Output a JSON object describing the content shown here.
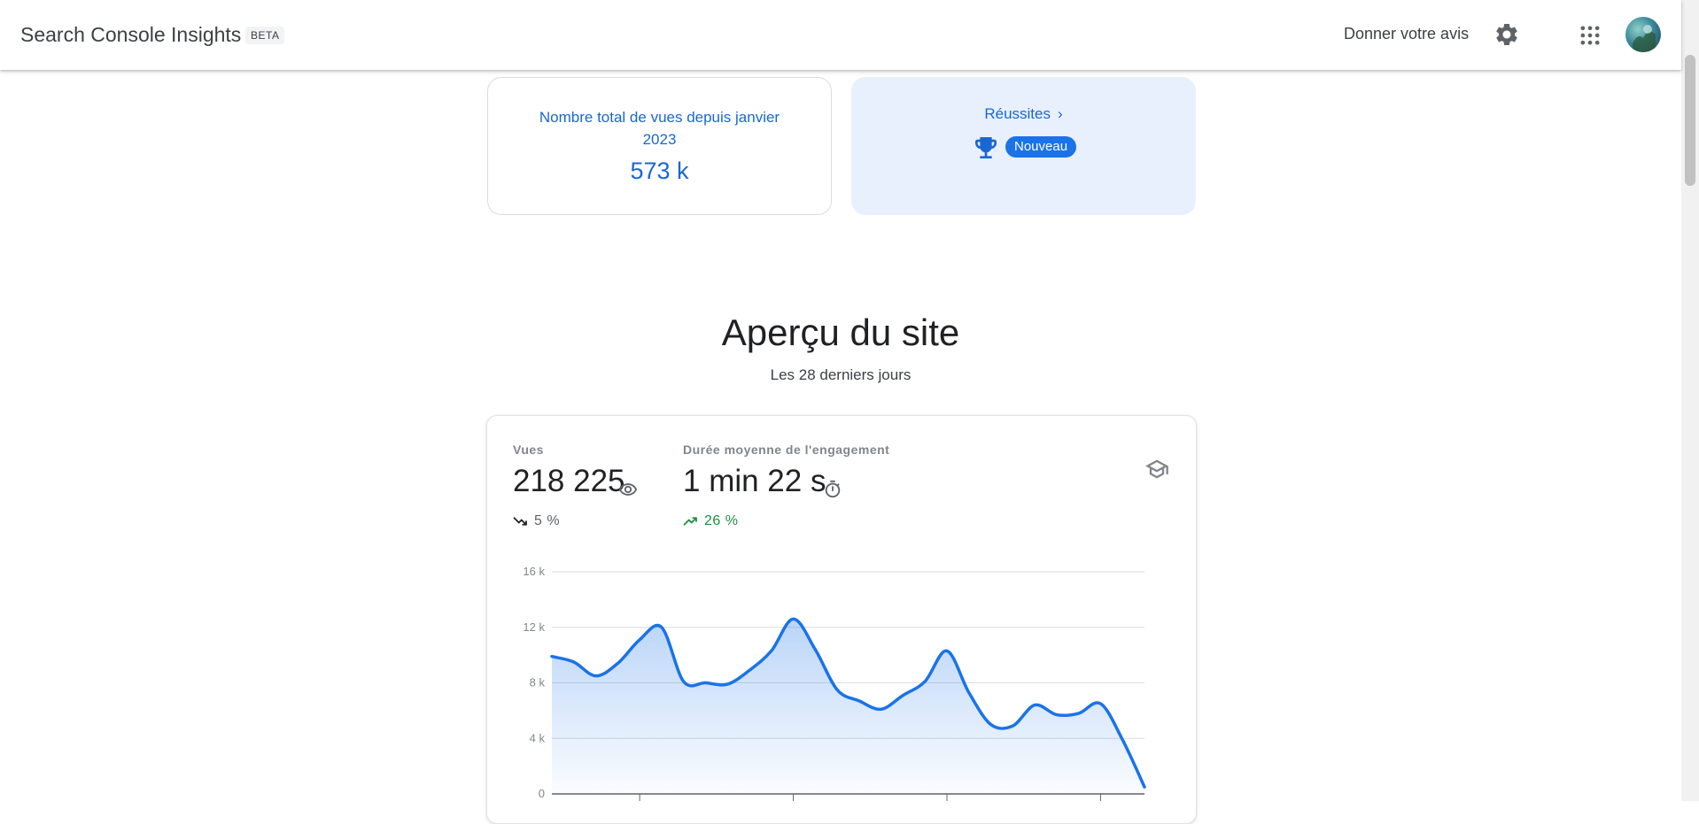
{
  "header": {
    "app_title": "Search Console Insights",
    "beta_label": "BETA",
    "feedback_label": "Donner votre avis",
    "icons": [
      "gear-icon",
      "apps-grid-icon",
      "account-avatar"
    ]
  },
  "summary": {
    "total_views_label": "Nombre total de vues depuis janvier 2023",
    "total_views_value": "573 k",
    "achievements_label": "Réussites",
    "achievements_badge": "Nouveau"
  },
  "overview": {
    "title": "Aperçu du site",
    "subtitle": "Les 28 derniers jours",
    "views_label": "Vues",
    "views_value": "218 225",
    "views_change": "5 %",
    "engagement_label": "Durée moyenne de l'engagement",
    "engagement_value": "1 min 22 s",
    "engagement_change": "26 %"
  },
  "colors": {
    "accent": "#1a73e8",
    "link": "#1967d2",
    "positive": "#1e8e3e",
    "negative": "#5f6368",
    "card_highlight": "#e8f0fe"
  },
  "chart_data": {
    "type": "area",
    "title": "",
    "xlabel": "",
    "ylabel": "",
    "y_ticks": [
      "16 k",
      "12 k",
      "8 k",
      "4 k",
      "0"
    ],
    "ylim": [
      0,
      16000
    ],
    "grid": true,
    "series": [
      {
        "values": [
          9900,
          9500,
          8500,
          9400,
          11100,
          12000,
          8100,
          8000,
          7900,
          8900,
          10300,
          12600,
          10400,
          7500,
          6700,
          6100,
          7100,
          8100,
          10300,
          7300,
          5000,
          4900,
          6400,
          5700,
          5800,
          6500,
          3900,
          500
        ]
      }
    ]
  }
}
